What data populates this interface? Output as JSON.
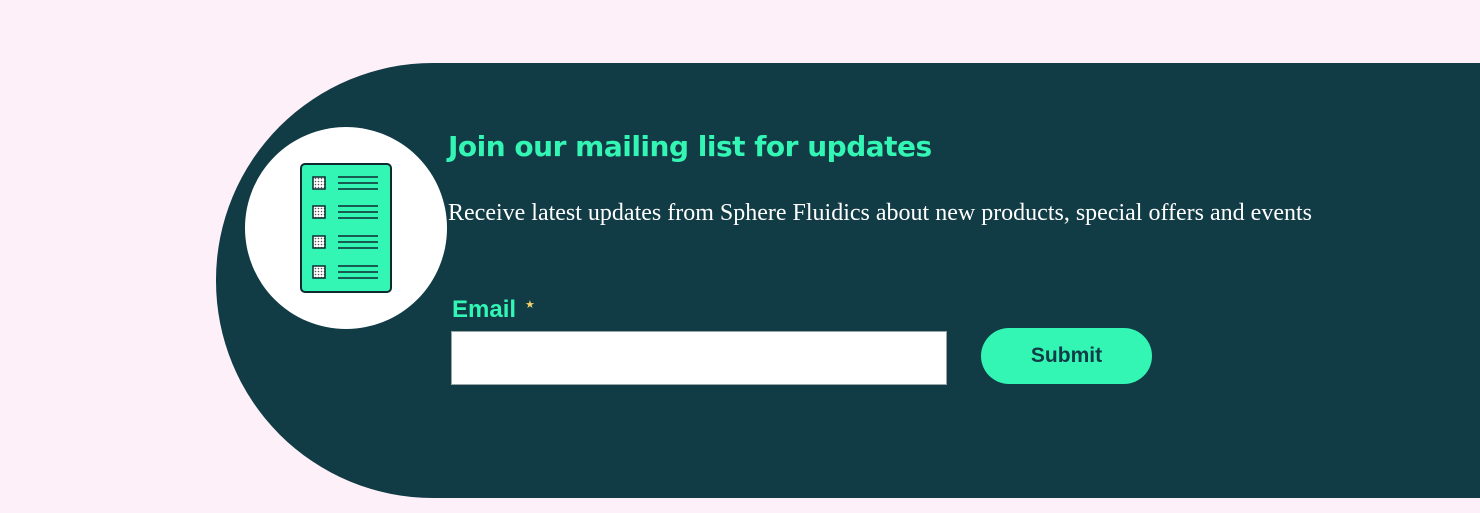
{
  "newsletter": {
    "title": "Join our mailing list for updates",
    "description": "Receive latest updates from Sphere Fluidics about new products, special offers and events",
    "email_label": "Email",
    "required_marker": "★",
    "email_value": "",
    "email_placeholder": "",
    "submit_label": "Submit",
    "icon": "checklist-icon"
  },
  "colors": {
    "page_background": "#fdf0f8",
    "banner_background": "#113b45",
    "accent": "#33f5b4",
    "required_marker": "#f2d06b",
    "text": "#ffffff"
  }
}
